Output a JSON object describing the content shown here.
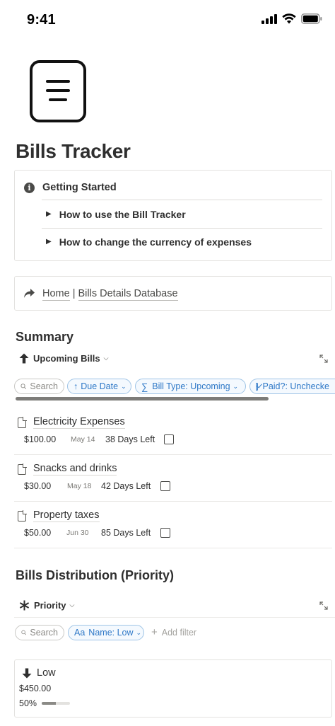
{
  "status_bar": {
    "time": "9:41"
  },
  "page": {
    "title": "Bills Tracker",
    "icon": "menu-lines-icon"
  },
  "callout": {
    "icon": "info-icon",
    "title": "Getting Started",
    "toggles": [
      "How to use the Bill Tracker",
      "How to change the currency of expenses"
    ]
  },
  "breadcrumb": {
    "icon": "share-arrow-icon",
    "home": "Home",
    "separator": " | ",
    "database": "Bills Details Database"
  },
  "summary": {
    "title": "Summary",
    "view_name": "Upcoming Bills",
    "view_icon": "arrow-up-icon",
    "filters": {
      "search": "Search",
      "sort": "Due Date",
      "bill_type": "Bill Type: Upcoming",
      "paid": "Paid?: Unchecke"
    },
    "cards": [
      {
        "title": "Electricity Expenses",
        "amount": "$100.00",
        "date": "May 14",
        "days_left": "38 Days Left",
        "checked": false
      },
      {
        "title": "Snacks and drinks",
        "amount": "$30.00",
        "date": "May 18",
        "days_left": "42 Days Left",
        "checked": false
      },
      {
        "title": "Property taxes",
        "amount": "$50.00",
        "date": "Jun 30",
        "days_left": "85 Days Left",
        "checked": false
      }
    ]
  },
  "distribution": {
    "title": "Bills Distribution (Priority)",
    "view_name": "Priority",
    "view_icon": "asterisk-icon",
    "filters": {
      "search": "Search",
      "name": "Name: Low",
      "add_filter": "Add filter"
    },
    "group": {
      "name": "Low",
      "icon": "arrow-down-icon",
      "amount": "$450.00",
      "percent_label": "50%",
      "percent": 0.5
    }
  },
  "colors": {
    "accent_blue": "#2e78c7",
    "text": "#37352f",
    "border": "#e3e2df"
  }
}
